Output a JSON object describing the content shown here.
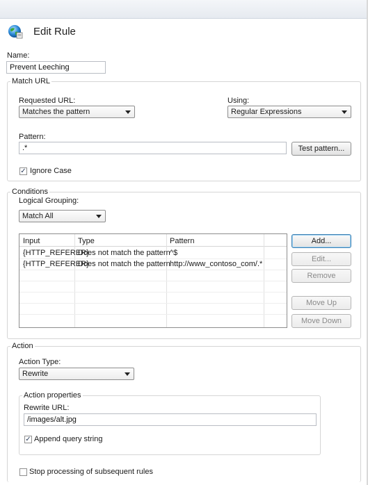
{
  "window": {
    "title": "Edit Rule"
  },
  "name": {
    "label": "Name:",
    "value": "Prevent Leeching"
  },
  "match_url": {
    "title": "Match URL",
    "requested_url_label": "Requested URL:",
    "requested_url_value": "Matches the pattern",
    "using_label": "Using:",
    "using_value": "Regular Expressions",
    "pattern_label": "Pattern:",
    "pattern_value": ".*",
    "test_pattern_button": "Test pattern...",
    "ignore_case_label": "Ignore Case",
    "ignore_case_checked": true
  },
  "conditions": {
    "title": "Conditions",
    "logical_grouping_label": "Logical Grouping:",
    "logical_grouping_value": "Match All",
    "columns": [
      "Input",
      "Type",
      "Pattern"
    ],
    "rows": [
      {
        "input": "{HTTP_REFERER}",
        "type": "Does not match the pattern",
        "pattern": "^$"
      },
      {
        "input": "{HTTP_REFERER}",
        "type": "Does not match the pattern",
        "pattern": "http://www_contoso_com/.*"
      }
    ],
    "buttons": {
      "add": "Add...",
      "edit": "Edit...",
      "remove": "Remove",
      "move_up": "Move Up",
      "move_down": "Move Down"
    }
  },
  "action": {
    "title": "Action",
    "action_type_label": "Action Type:",
    "action_type_value": "Rewrite",
    "properties_title": "Action properties",
    "rewrite_url_label": "Rewrite URL:",
    "rewrite_url_value": "/images/alt.jpg",
    "append_query_label": "Append query string",
    "append_query_checked": true,
    "stop_processing_label": "Stop processing of subsequent rules",
    "stop_processing_checked": false
  },
  "icons": {
    "title_icon": "globe-icon"
  },
  "colors": {
    "default_button_border": "#3c7fb1",
    "disabled_text": "#8a8a8a"
  }
}
